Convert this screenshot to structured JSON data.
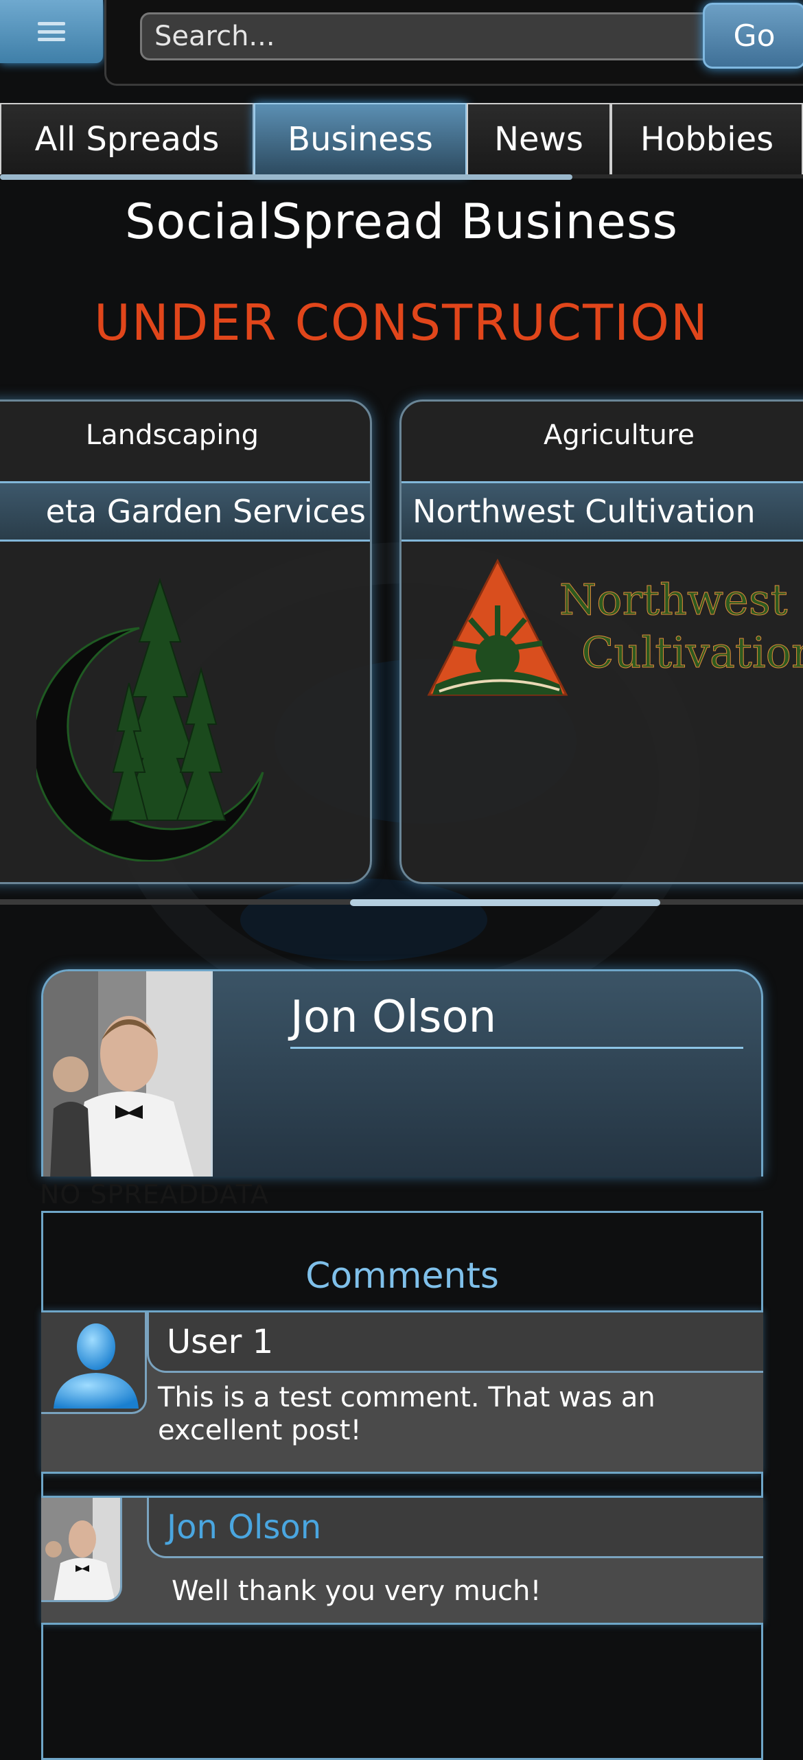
{
  "header": {
    "search_placeholder": "Search...",
    "go_label": "Go"
  },
  "tabs": [
    {
      "label": "All Spreads"
    },
    {
      "label": "Business"
    },
    {
      "label": "News"
    },
    {
      "label": "Hobbies"
    }
  ],
  "page": {
    "title": "SocialSpread Business",
    "notice": "UNDER CONSTRUCTION"
  },
  "businesses": [
    {
      "category": "Landscaping",
      "name": "eta Garden Services"
    },
    {
      "category": "Agriculture",
      "name": "Northwest Cultivation",
      "logo_text_line1": "Northwest",
      "logo_text_line2": "Cultivation"
    }
  ],
  "profile": {
    "name": "Jon Olson",
    "no_data": "NO SPREADDATA"
  },
  "comments": {
    "title": "Comments",
    "items": [
      {
        "author": "User 1",
        "text": " This is a test comment. That was an excellent post!"
      },
      {
        "author": "Jon Olson",
        "text": "Well thank you very much!"
      }
    ]
  },
  "colors": {
    "accent_blue": "#6fa6c8",
    "construction_orange": "#e1461b",
    "link_blue": "#4aa6e0"
  },
  "icons": [
    "menu-icon",
    "user-silhouette-icon"
  ]
}
